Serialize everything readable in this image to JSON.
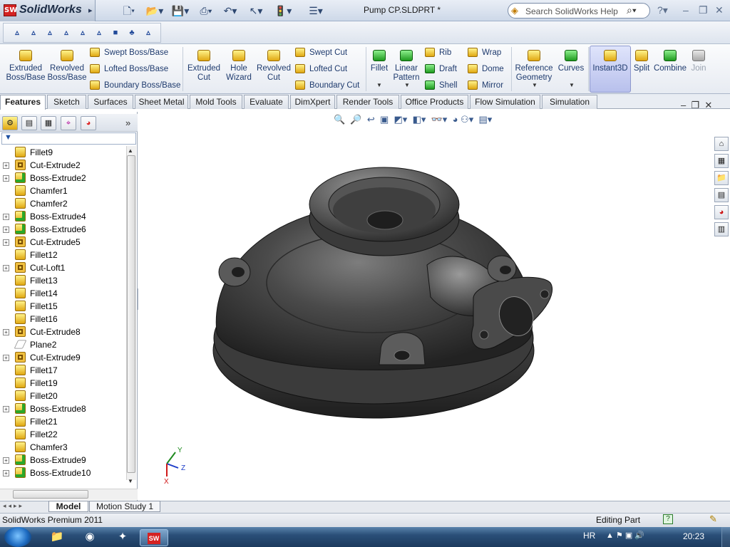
{
  "app": {
    "name": "SolidWorks",
    "document_title": "Pump CP.SLDPRT *",
    "search_placeholder": "Search SolidWorks Help"
  },
  "quick_access": [
    {
      "name": "new-file-icon",
      "glyph": "🗋"
    },
    {
      "name": "open-folder-icon",
      "glyph": "📂"
    },
    {
      "name": "save-icon",
      "glyph": "💾"
    },
    {
      "name": "print-icon",
      "glyph": "⎙"
    },
    {
      "name": "undo-icon",
      "glyph": "↶"
    },
    {
      "name": "select-arrow-icon",
      "glyph": "↖"
    },
    {
      "name": "rebuild-icon",
      "glyph": "🚦"
    },
    {
      "name": "options-icon",
      "glyph": "☰"
    }
  ],
  "sketch_tools": [
    "▵",
    "▵",
    "▵",
    "▵",
    "▵",
    "▵",
    "■",
    "♣",
    "▵"
  ],
  "ribbon": {
    "large_buttons": [
      {
        "id": "extruded-boss-base",
        "label1": "Extruded",
        "label2": "Boss/Base",
        "color": "yel"
      },
      {
        "id": "revolved-boss-base",
        "label1": "Revolved",
        "label2": "Boss/Base",
        "color": "yel"
      },
      {
        "id": "extruded-cut",
        "label1": "Extruded",
        "label2": "Cut",
        "color": "yel"
      },
      {
        "id": "hole-wizard",
        "label1": "Hole",
        "label2": "Wizard",
        "color": "yel"
      },
      {
        "id": "revolved-cut",
        "label1": "Revolved",
        "label2": "Cut",
        "color": "yel"
      },
      {
        "id": "fillet",
        "label1": "Fillet",
        "label2": "",
        "color": "grn"
      },
      {
        "id": "linear-pattern",
        "label1": "Linear",
        "label2": "Pattern",
        "color": "grn"
      },
      {
        "id": "reference-geometry",
        "label1": "Reference",
        "label2": "Geometry",
        "color": "yel"
      },
      {
        "id": "curves",
        "label1": "Curves",
        "label2": "",
        "color": "grn"
      },
      {
        "id": "instant3d",
        "label1": "Instant3D",
        "label2": "",
        "color": "yel"
      },
      {
        "id": "split",
        "label1": "Split",
        "label2": "",
        "color": "yel"
      },
      {
        "id": "combine",
        "label1": "Combine",
        "label2": "",
        "color": "grn"
      },
      {
        "id": "join",
        "label1": "Join",
        "label2": "",
        "color": "gry"
      }
    ],
    "small_buttons": [
      {
        "id": "swept-boss-base",
        "label": "Swept Boss/Base",
        "color": "yel"
      },
      {
        "id": "lofted-boss-base",
        "label": "Lofted Boss/Base",
        "color": "yel"
      },
      {
        "id": "boundary-boss-base",
        "label": "Boundary Boss/Base",
        "color": "yel"
      },
      {
        "id": "swept-cut",
        "label": "Swept Cut",
        "color": "yel"
      },
      {
        "id": "lofted-cut",
        "label": "Lofted Cut",
        "color": "yel"
      },
      {
        "id": "boundary-cut",
        "label": "Boundary Cut",
        "color": "yel"
      },
      {
        "id": "rib",
        "label": "Rib",
        "color": "yel"
      },
      {
        "id": "draft",
        "label": "Draft",
        "color": "grn"
      },
      {
        "id": "shell",
        "label": "Shell",
        "color": "grn"
      },
      {
        "id": "wrap",
        "label": "Wrap",
        "color": "yel"
      },
      {
        "id": "dome",
        "label": "Dome",
        "color": "yel"
      },
      {
        "id": "mirror",
        "label": "Mirror",
        "color": "yel"
      }
    ]
  },
  "tabs": [
    "Features",
    "Sketch",
    "Surfaces",
    "Sheet Metal",
    "Mold Tools",
    "Evaluate",
    "DimXpert",
    "Render Tools",
    "Office Products",
    "Flow Simulation",
    "Simulation"
  ],
  "active_tab": "Features",
  "feature_tree": [
    {
      "label": "Fillet9",
      "expandable": false,
      "kind": "fillet"
    },
    {
      "label": "Cut-Extrude2",
      "expandable": true,
      "kind": "cut"
    },
    {
      "label": "Boss-Extrude2",
      "expandable": true,
      "kind": "boss"
    },
    {
      "label": "Chamfer1",
      "expandable": false,
      "kind": "fillet"
    },
    {
      "label": "Chamfer2",
      "expandable": false,
      "kind": "fillet"
    },
    {
      "label": "Boss-Extrude4",
      "expandable": true,
      "kind": "boss"
    },
    {
      "label": "Boss-Extrude6",
      "expandable": true,
      "kind": "boss"
    },
    {
      "label": "Cut-Extrude5",
      "expandable": true,
      "kind": "cut"
    },
    {
      "label": "Fillet12",
      "expandable": false,
      "kind": "fillet"
    },
    {
      "label": "Cut-Loft1",
      "expandable": true,
      "kind": "cut"
    },
    {
      "label": "Fillet13",
      "expandable": false,
      "kind": "fillet"
    },
    {
      "label": "Fillet14",
      "expandable": false,
      "kind": "fillet"
    },
    {
      "label": "Fillet15",
      "expandable": false,
      "kind": "fillet"
    },
    {
      "label": "Fillet16",
      "expandable": false,
      "kind": "fillet"
    },
    {
      "label": "Cut-Extrude8",
      "expandable": true,
      "kind": "cut"
    },
    {
      "label": "Plane2",
      "expandable": false,
      "kind": "plane"
    },
    {
      "label": "Cut-Extrude9",
      "expandable": true,
      "kind": "cut"
    },
    {
      "label": "Fillet17",
      "expandable": false,
      "kind": "fillet"
    },
    {
      "label": "Fillet19",
      "expandable": false,
      "kind": "fillet"
    },
    {
      "label": "Fillet20",
      "expandable": false,
      "kind": "fillet"
    },
    {
      "label": "Boss-Extrude8",
      "expandable": true,
      "kind": "boss"
    },
    {
      "label": "Fillet21",
      "expandable": false,
      "kind": "fillet"
    },
    {
      "label": "Fillet22",
      "expandable": false,
      "kind": "fillet"
    },
    {
      "label": "Chamfer3",
      "expandable": false,
      "kind": "fillet"
    },
    {
      "label": "Boss-Extrude9",
      "expandable": true,
      "kind": "boss"
    },
    {
      "label": "Boss-Extrude10",
      "expandable": true,
      "kind": "boss"
    }
  ],
  "triad": {
    "x": "X",
    "y": "Y",
    "z": "Z"
  },
  "bottom_tabs": [
    "Model",
    "Motion Study 1"
  ],
  "status": {
    "left": "SolidWorks Premium 2011",
    "right": "Editing Part"
  },
  "taskbar": {
    "language": "HR",
    "time": "20:23"
  },
  "colors": {
    "model": "#3a3a3a",
    "accent": "#1f3b6e",
    "taskbar": "#1c3a5e"
  }
}
